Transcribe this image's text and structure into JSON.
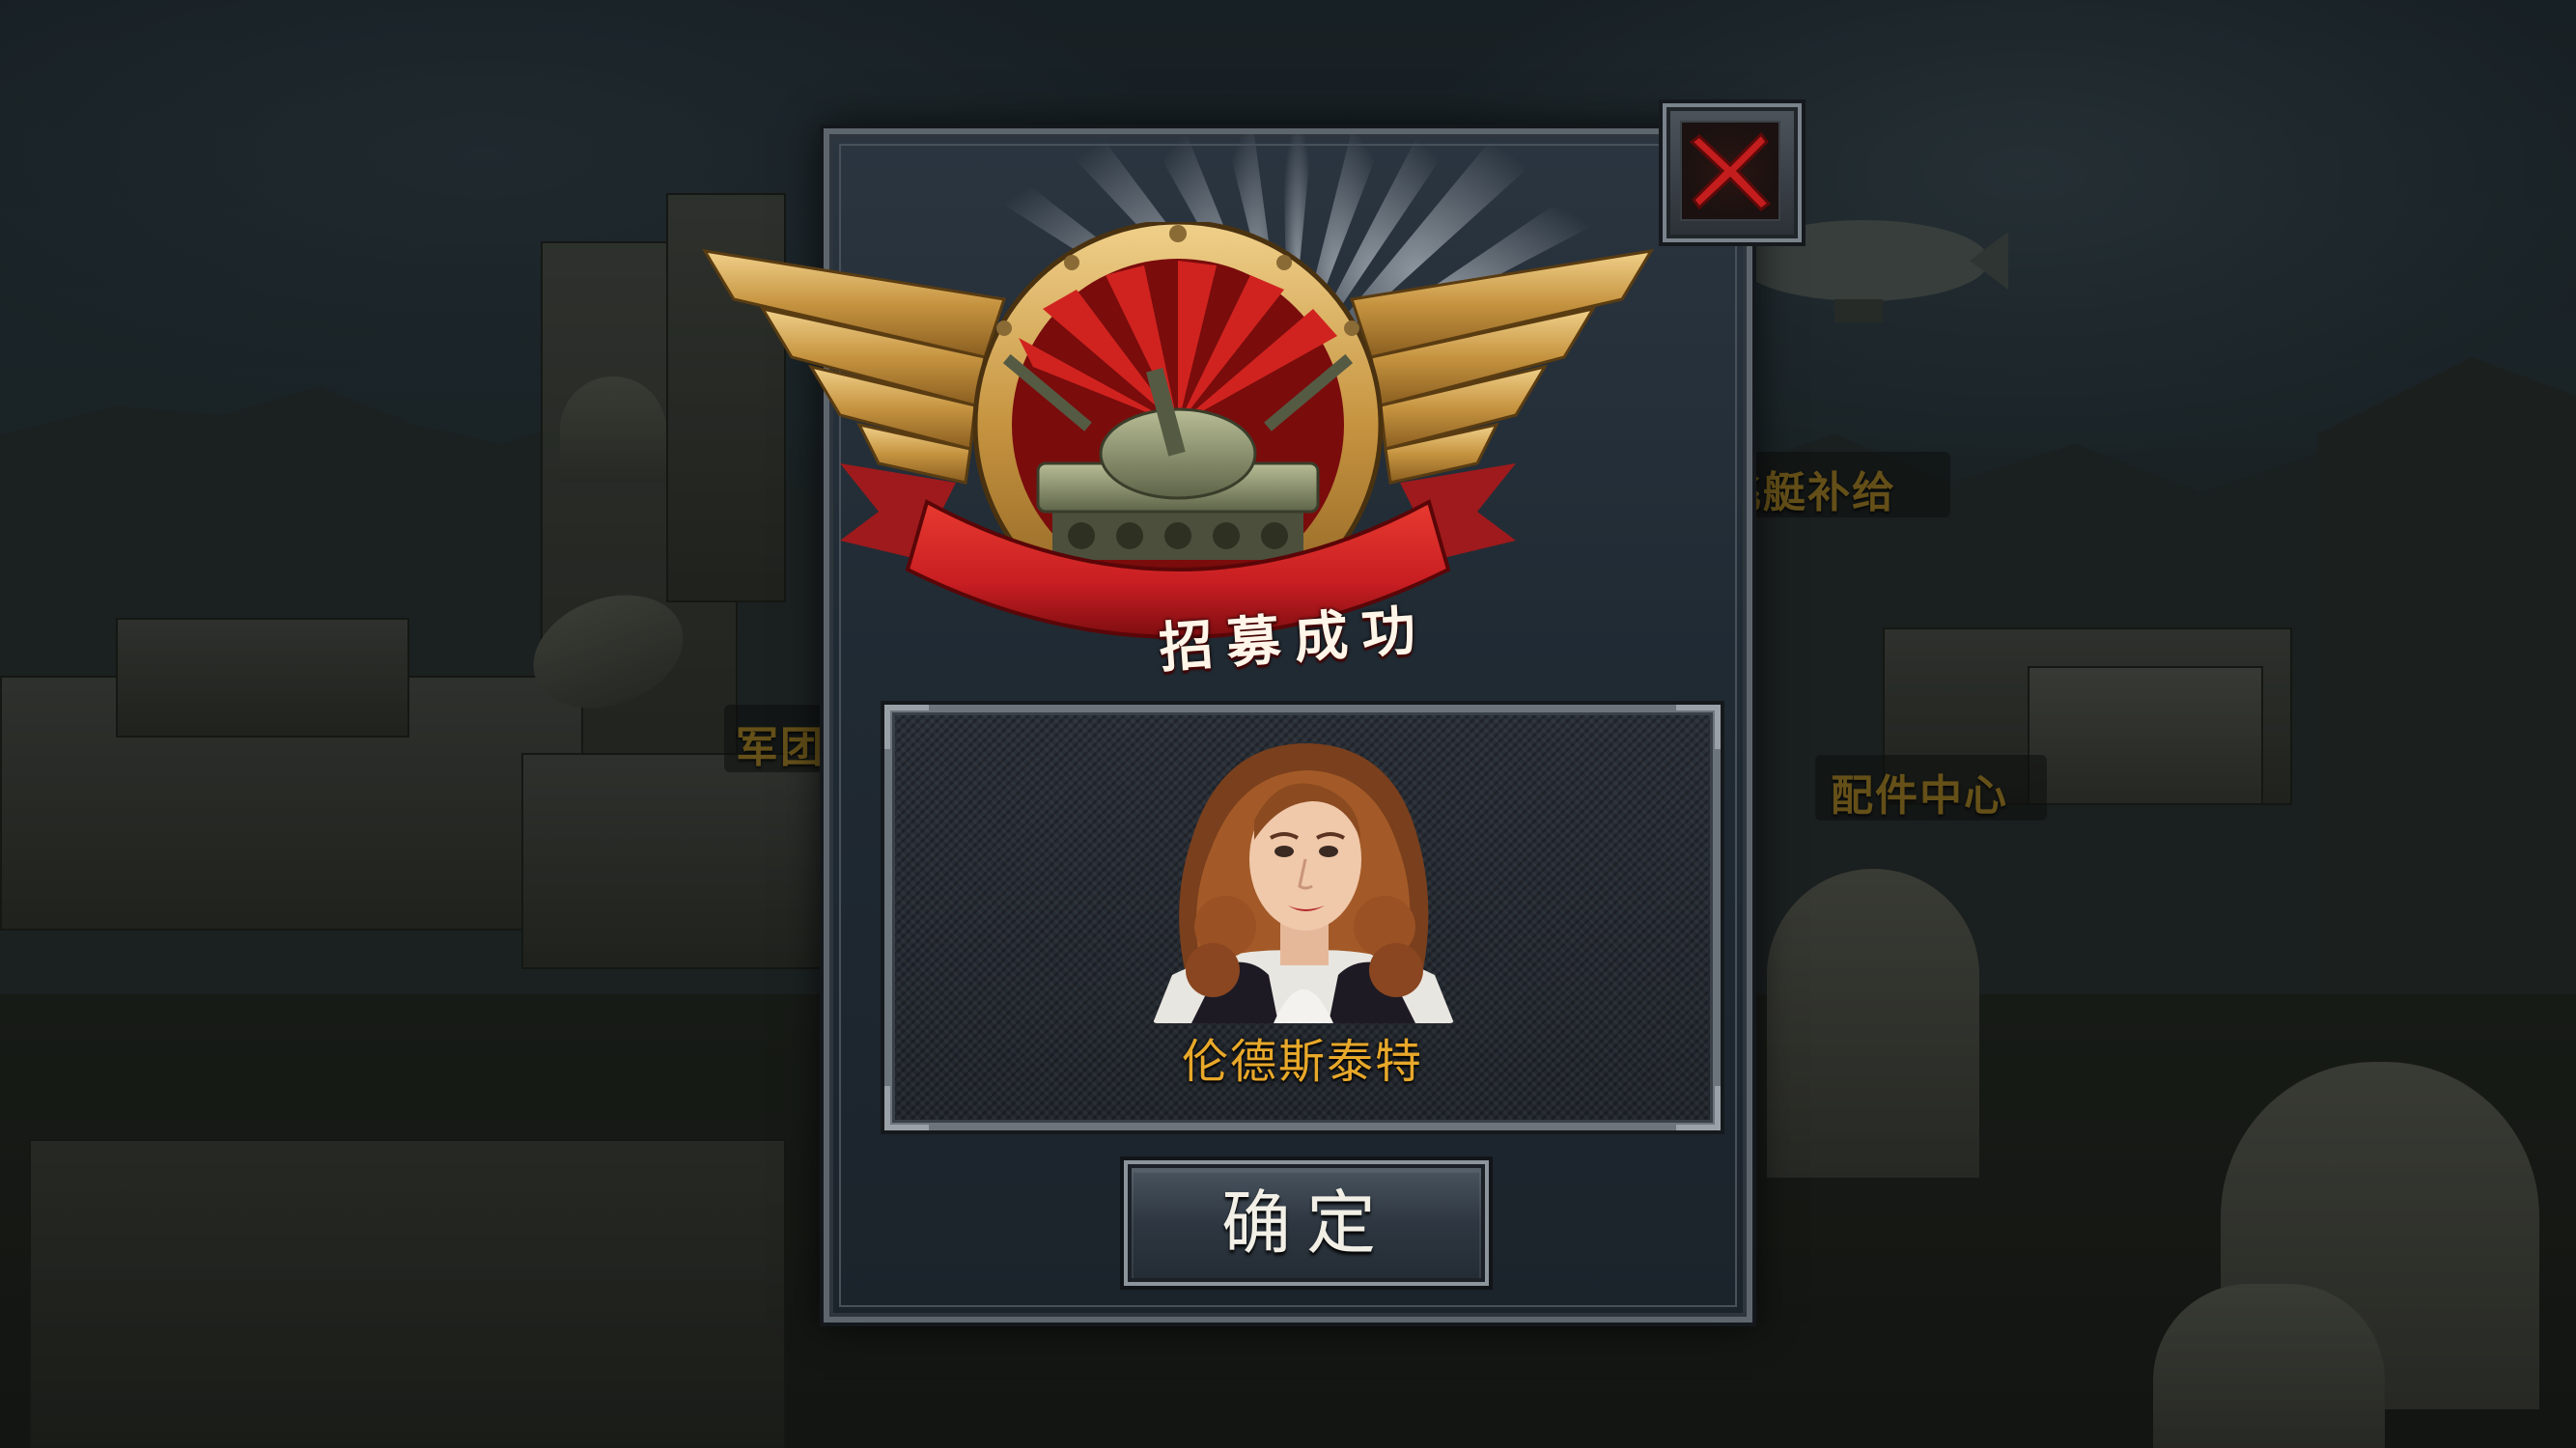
{
  "background": {
    "building_labels": [
      {
        "text": "军团"
      },
      {
        "text": "飞艇补给"
      },
      {
        "text": "配件中心"
      }
    ]
  },
  "dialog": {
    "banner_text": "招募成功",
    "character_name": "伦德斯泰特",
    "confirm_label": "确定",
    "close_icon": "close-x-icon"
  },
  "colors": {
    "accent_gold": "#e8a82a",
    "banner_red": "#c81e22",
    "close_red": "#b01818"
  }
}
